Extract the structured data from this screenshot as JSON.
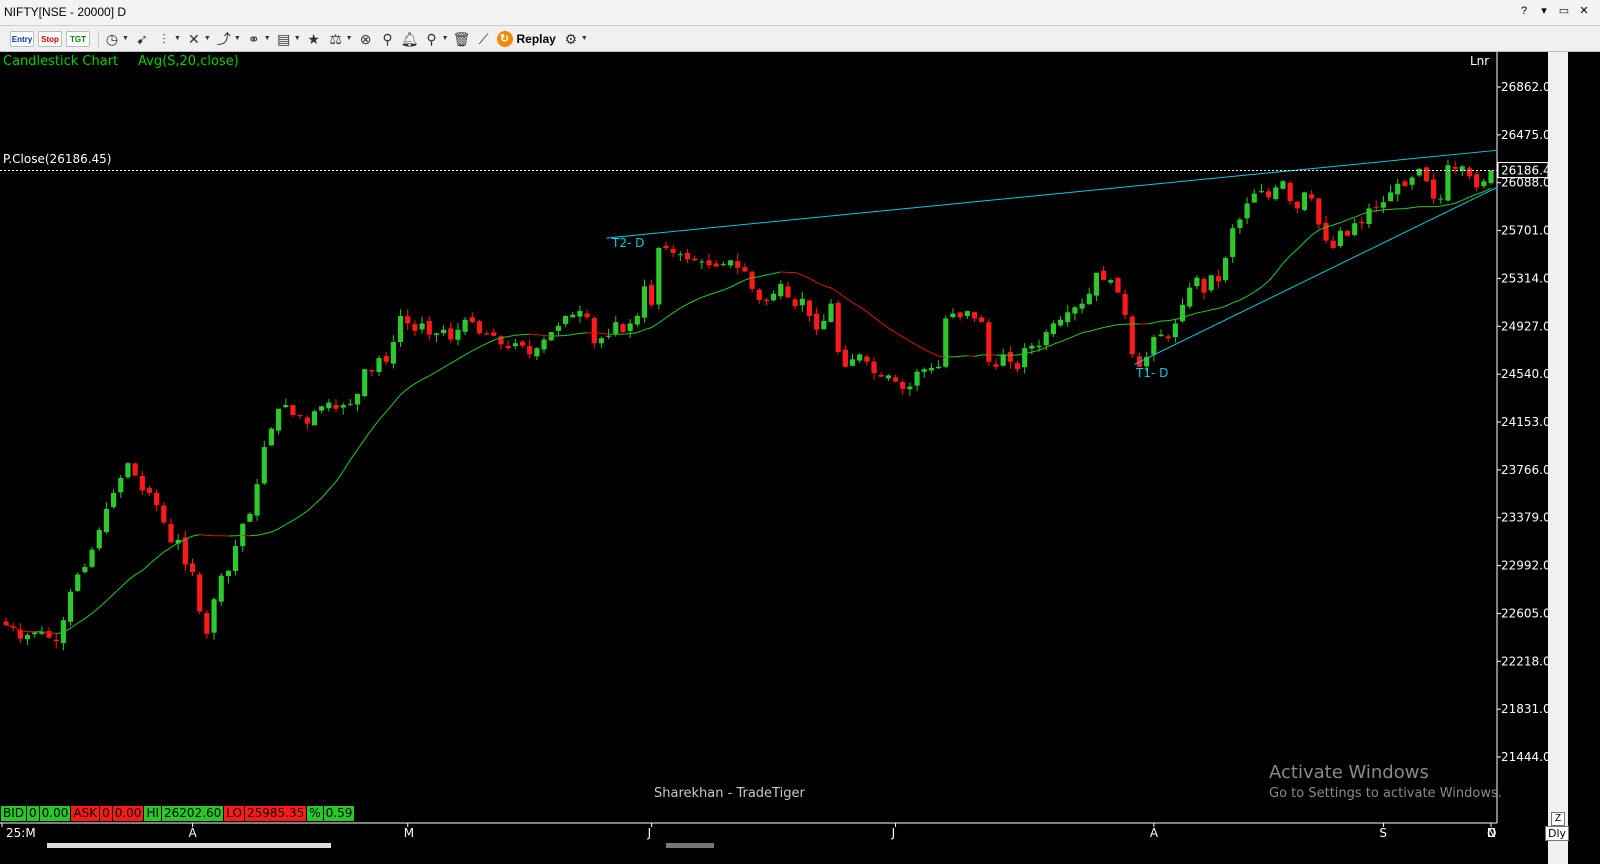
{
  "window": {
    "title": "NIFTY[NSE - 20000] D",
    "controls": [
      "?",
      "▾",
      "▭",
      "✕"
    ]
  },
  "toolbar": {
    "entry_label": "Entry",
    "stop_label": "Stop",
    "tgt_label": "TGT",
    "replay_label": "Replay",
    "icons": [
      "clock-icon",
      "cursor-icon",
      "chart-type-icon",
      "crosshair-icon",
      "draw-tools-icon",
      "link-icon",
      "template-icon",
      "favorite-star-icon",
      "indicator-icon",
      "scanner-icon",
      "pin-icon",
      "alert-bell-icon",
      "zoom-icon",
      "delete-icon",
      "line-chart-icon",
      "replay-icon",
      "settings-gear-icon"
    ]
  },
  "chart_header": {
    "chart_label": "Candlestick Chart",
    "study_label": "Avg(S,20,close)",
    "scale_label": "Lnr",
    "pclose_label": "P.Close(26186.45)",
    "pclose_badge": "26186.45"
  },
  "trendlines": {
    "t1_label": "T1- D",
    "t2_label": "T2- D"
  },
  "watermark": "Sharekhan - TradeTiger",
  "activate": {
    "title": "Activate Windows",
    "subtitle": "Go to Settings to activate Windows."
  },
  "stats": [
    {
      "text": "BID",
      "color": "green"
    },
    {
      "text": "0",
      "color": "green"
    },
    {
      "text": "0.00",
      "color": "green"
    },
    {
      "text": "ASK",
      "color": "red"
    },
    {
      "text": "0",
      "color": "red"
    },
    {
      "text": "0.00",
      "color": "red"
    },
    {
      "text": "HI",
      "color": "green"
    },
    {
      "text": "26202.60",
      "color": "green"
    },
    {
      "text": "LO",
      "color": "red"
    },
    {
      "text": "25985.35",
      "color": "red"
    },
    {
      "text": "%",
      "color": "green"
    },
    {
      "text": "0.59",
      "color": "green"
    }
  ],
  "bottom": {
    "zoom_label": "Z",
    "period_label": "Dly"
  },
  "colors": {
    "up": "#2ec82e",
    "down": "#ff1a1a",
    "ma_up": "#22cc22",
    "ma_down": "#dd1111",
    "trendline": "#00cde0",
    "axis_text": "#ffffff"
  },
  "chart_data": {
    "type": "candlestick",
    "title": "",
    "symbol": "NIFTY",
    "yaxis_ticks": [
      26862.0,
      26475.0,
      26088.0,
      25701.0,
      25314.0,
      24927.0,
      24540.0,
      24153.0,
      23766.0,
      23379.0,
      22992.0,
      22605.0,
      22218.0,
      21831.0,
      21444.0
    ],
    "yaxis_tick_labels": [
      "26862.00",
      "26475.00",
      "26088.00",
      "25701.00",
      "25314.00",
      "24927.00",
      "24540.00",
      "24153.00",
      "23766.00",
      "23379.00",
      "22992.00",
      "22605.00",
      "22218.00",
      "21831.00",
      "21444.00"
    ],
    "ylim": [
      21192,
      26992
    ],
    "x_ticks": [
      "25:M",
      "A",
      "M",
      "J",
      "J",
      "A",
      "S",
      "O",
      "N",
      "D"
    ],
    "prev_close": 26186.45,
    "trendline_t1": {
      "from": [
        0.758,
        24620
      ],
      "to": [
        1.0,
        26050
      ]
    },
    "trendline_t2": {
      "from": [
        0.405,
        25640
      ],
      "to": [
        1.0,
        26350
      ]
    },
    "ma_period": 20,
    "closes": [
      22510,
      22490,
      22400,
      22430,
      22450,
      22460,
      22410,
      22380,
      22550,
      22780,
      22920,
      22980,
      23120,
      23280,
      23450,
      23580,
      23700,
      23820,
      23720,
      23600,
      23580,
      23480,
      23340,
      23180,
      23200,
      23000,
      22940,
      22620,
      22440,
      22720,
      22910,
      22950,
      23150,
      23330,
      23410,
      23650,
      23950,
      24100,
      24260,
      24290,
      24210,
      24200,
      24140,
      24240,
      24280,
      24310,
      24260,
      24290,
      24300,
      24380,
      24580,
      24560,
      24670,
      24640,
      24800,
      25010,
      24950,
      24890,
      24950,
      24860,
      24870,
      24900,
      24820,
      24900,
      24980,
      24960,
      24870,
      24860,
      24850,
      24780,
      24750,
      24790,
      24770,
      24700,
      24750,
      24820,
      24880,
      24930,
      25010,
      25020,
      25050,
      25000,
      24790,
      24830,
      24850,
      24960,
      24880,
      24950,
      25010,
      25250,
      25100,
      25560,
      25560,
      25520,
      25510,
      25470,
      25460,
      25450,
      25420,
      25410,
      25430,
      25460,
      25400,
      25370,
      25230,
      25140,
      25130,
      25190,
      25270,
      25160,
      25090,
      25150,
      25010,
      24900,
      24970,
      25110,
      24720,
      24600,
      24660,
      24700,
      24640,
      24550,
      24520,
      24530,
      24480,
      24420,
      24440,
      24560,
      24580,
      24590,
      24600,
      24990,
      25030,
      25000,
      25050,
      24990,
      24960,
      24640,
      24600,
      24700,
      24640,
      24580,
      24750,
      24770,
      24770,
      24880,
      24950,
      24980,
      25040,
      25080,
      25110,
      25190,
      25360,
      25300,
      25300,
      25200,
      25020,
      24700,
      24600,
      24680,
      24840,
      24860,
      24830,
      24950,
      25100,
      25240,
      25320,
      25200,
      25340,
      25290,
      25480,
      25720,
      25790,
      25920,
      26000,
      26020,
      25970,
      26050,
      26100,
      25940,
      25880,
      26010,
      25960,
      25750,
      25620,
      25560,
      25700,
      25660,
      25760,
      25760,
      25880,
      25890,
      25930,
      26010,
      26080,
      26060,
      26130,
      26200,
      26100,
      25960,
      25960,
      26230,
      26200,
      26220,
      26140,
      26050,
      26100,
      26186
    ]
  }
}
